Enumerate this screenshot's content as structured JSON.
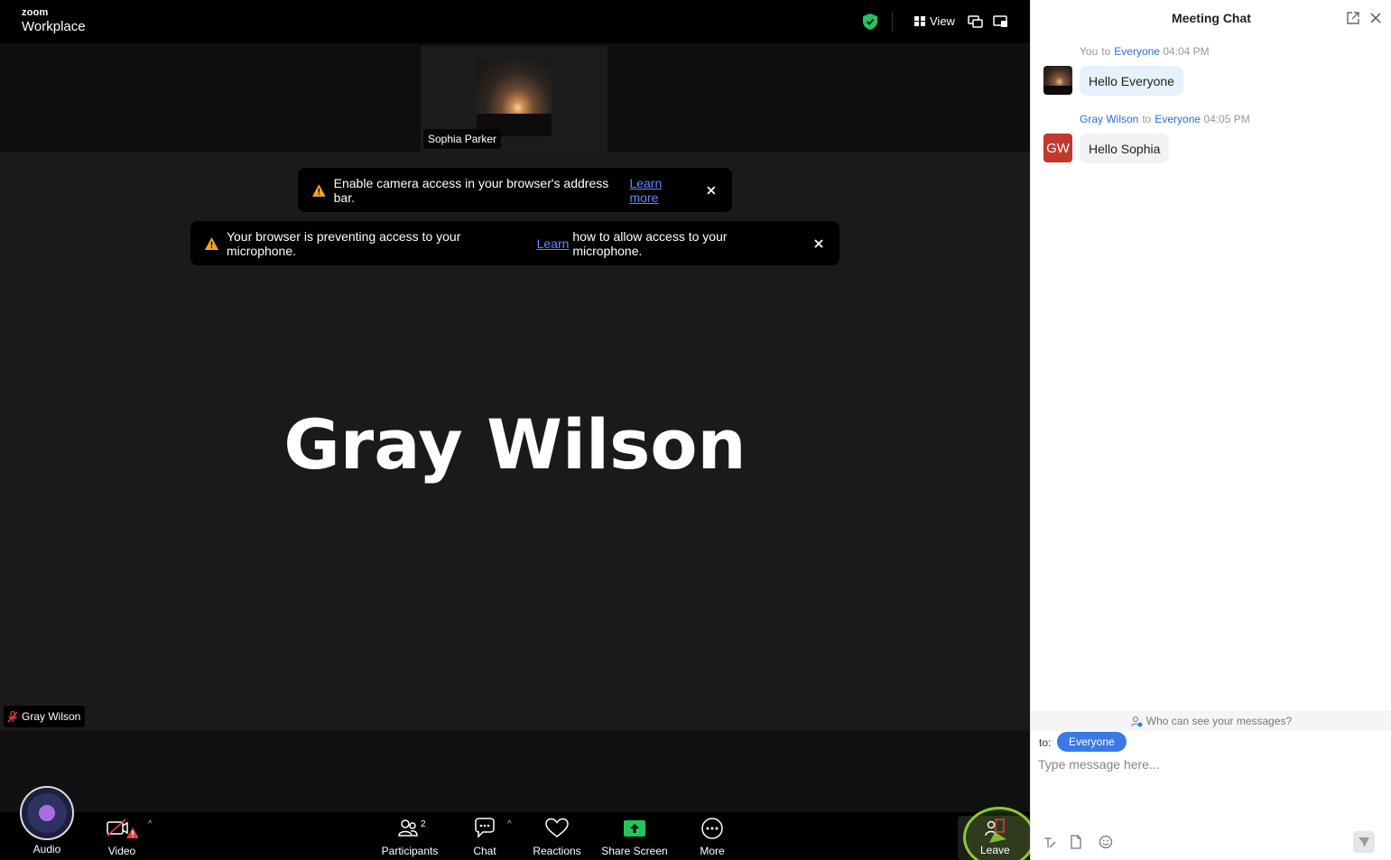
{
  "app": {
    "logo_small": "zoom",
    "logo_name": "Workplace"
  },
  "header": {
    "view_label": "View"
  },
  "participant_strip": {
    "tile_name": "Sophia Parker"
  },
  "toasts": {
    "camera": {
      "text": "Enable camera access in your browser's address bar.",
      "link": "Learn more"
    },
    "microphone": {
      "text_before": "Your browser is preventing access to your microphone.",
      "link": "Learn",
      "text_after": "how to allow access to your microphone."
    }
  },
  "main": {
    "speaker_name": "Gray Wilson",
    "self_label": "Gray Wilson"
  },
  "toolbar": {
    "audio": "Audio",
    "video": "Video",
    "participants": "Participants",
    "participants_count": "2",
    "chat": "Chat",
    "reactions": "Reactions",
    "share_screen": "Share Screen",
    "more": "More",
    "leave": "Leave"
  },
  "chat": {
    "title": "Meeting Chat",
    "messages": [
      {
        "sender": "You",
        "to_word": "to",
        "recipient": "Everyone",
        "time": "04:04 PM",
        "text": "Hello Everyone"
      },
      {
        "sender": "Gray Wilson",
        "to_word": "to",
        "recipient": "Everyone",
        "time": "04:05 PM",
        "text": "Hello Sophia",
        "avatar_initials": "GW"
      }
    ],
    "visibility_text": "Who can see your messages?",
    "to_label": "to:",
    "recipient": "Everyone",
    "input_placeholder": "Type message here..."
  },
  "colors": {
    "accent_blue": "#3b79e8",
    "avatar_red": "#c0392b",
    "secure_green": "#22c55e",
    "warning_amber": "#f5a623",
    "share_green": "#22c55e",
    "leave_highlight": "#8acb2a"
  }
}
